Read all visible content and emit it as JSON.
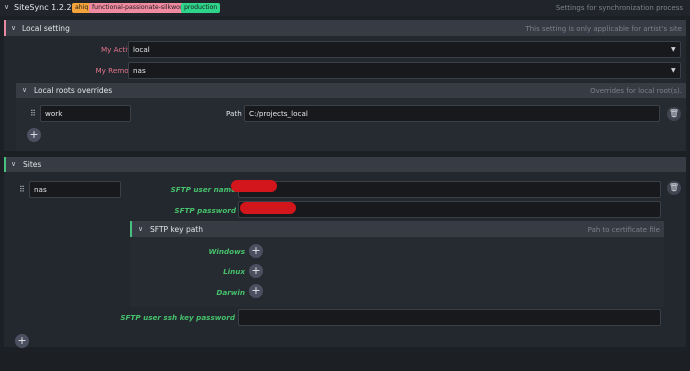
{
  "app": {
    "title": "SiteSync 1.2.2",
    "badges": [
      {
        "label": "ahiq",
        "color": "#f4a33a"
      },
      {
        "label": "functional-passionate-silkworm",
        "color": "#f08aa0"
      },
      {
        "label": "production",
        "color": "#2ed48a"
      }
    ],
    "hint": "Settings for synchronization process"
  },
  "local_setting": {
    "title": "Local setting",
    "hint": "This setting is only applicable for artist's site",
    "active_site_label": "My Active Site",
    "active_site_value": "local",
    "remote_site_label": "My Remote Site",
    "remote_site_value": "nas",
    "overrides": {
      "title": "Local roots overrides",
      "hint": "Overrides for local root(s).",
      "root_name": "work",
      "path_label": "Path",
      "path_value": "C:/projects_local"
    }
  },
  "sites": {
    "title": "Sites",
    "site_name": "nas",
    "sftp_user_name_label": "SFTP user name",
    "sftp_password_label": "SFTP password",
    "key_path": {
      "title": "SFTP key path",
      "hint": "Pah to certificate file",
      "platforms": [
        "Windows",
        "Linux",
        "Darwin"
      ]
    },
    "ssh_key_password_label": "SFTP user ssh key password"
  },
  "icons": {
    "chevron": "chevron-down-icon",
    "add": "plus-icon",
    "remove": "trash-icon",
    "drag": "drag-handle-icon"
  }
}
